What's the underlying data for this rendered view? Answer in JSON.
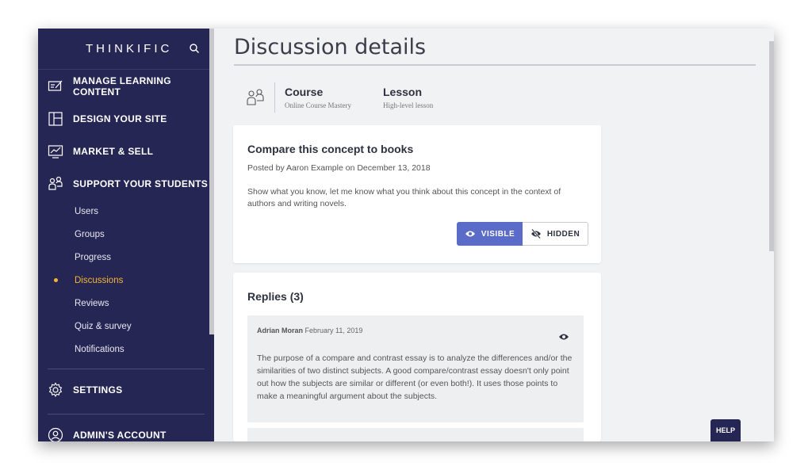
{
  "sidebar": {
    "brand": "THINKIFIC",
    "sections": [
      {
        "label": "MANAGE LEARNING CONTENT",
        "icon": "edit-screen-icon"
      },
      {
        "label": "DESIGN YOUR SITE",
        "icon": "layout-icon"
      },
      {
        "label": "MARKET & SELL",
        "icon": "chart-icon"
      },
      {
        "label": "SUPPORT YOUR STUDENTS",
        "icon": "students-icon"
      }
    ],
    "support_items": [
      "Users",
      "Groups",
      "Progress",
      "Discussions",
      "Reviews",
      "Quiz & survey",
      "Notifications"
    ],
    "active_item": "Discussions",
    "settings_label": "SETTINGS",
    "account_label": "ADMIN'S ACCOUNT"
  },
  "page": {
    "title": "Discussion details",
    "course_label": "Course",
    "course_value": "Online Course Mastery",
    "lesson_label": "Lesson",
    "lesson_value": "High-level lesson"
  },
  "discussion": {
    "title": "Compare this concept to books",
    "posted": "Posted by Aaron Example on December 13, 2018",
    "body": "Show what you know, let me know what you think about this concept in the context of authors and writing novels.",
    "visible_label": "VISIBLE",
    "hidden_label": "HIDDEN",
    "visibility": "visible"
  },
  "replies": {
    "title": "Replies (3)",
    "items": [
      {
        "author": "Adrian Moran",
        "date": "February 11, 2019",
        "body": "The purpose of a compare and contrast essay is to analyze the differences and/or the similarities of two distinct subjects. A good compare/contrast essay doesn't only point out how the subjects are similar or different (or even both!). It uses those points to make a meaningful argument about the subjects."
      }
    ]
  },
  "help_label": "HELP",
  "colors": {
    "sidebar": "#262654",
    "accent": "#5a6bc8",
    "active": "#f5b531"
  }
}
